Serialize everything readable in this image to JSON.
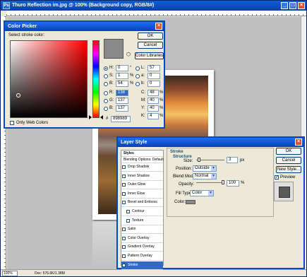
{
  "document": {
    "title": "Thuro Reflection im.jpg @ 100% (Background copy, RGB/8#)",
    "zoom": "100%",
    "info": "Doc: 576.6K/1.38M"
  },
  "color_picker": {
    "title": "Color Picker",
    "prompt": "Select stroke color:",
    "ok_label": "OK",
    "cancel_label": "Cancel",
    "libraries_label": "Color Libraries",
    "only_web_colors_label": "Only Web Colors",
    "hex_label": "#",
    "hex_value": "898989",
    "new_color": "#898989",
    "fields": {
      "H": {
        "label": "H:",
        "value": "0",
        "unit": "°"
      },
      "S": {
        "label": "S:",
        "value": "1",
        "unit": "%"
      },
      "B": {
        "label": "B:",
        "value": "54",
        "unit": "%"
      },
      "R": {
        "label": "R:",
        "value": "138"
      },
      "G": {
        "label": "G:",
        "value": "137"
      },
      "Bl": {
        "label": "B:",
        "value": "137"
      },
      "L": {
        "label": "L:",
        "value": "57"
      },
      "a": {
        "label": "a:",
        "value": "0"
      },
      "b": {
        "label": "b:",
        "value": "0"
      },
      "C": {
        "label": "C:",
        "value": "48",
        "unit": "%"
      },
      "M": {
        "label": "M:",
        "value": "40",
        "unit": "%"
      },
      "Y": {
        "label": "Y:",
        "value": "40",
        "unit": "%"
      },
      "K": {
        "label": "K:",
        "value": "4",
        "unit": "%"
      }
    }
  },
  "layer_style": {
    "title": "Layer Style",
    "styles_header": "Styles",
    "blending_options": "Blending Options: Default",
    "style_items": [
      {
        "label": "Drop Shadow",
        "checked": false
      },
      {
        "label": "Inner Shadow",
        "checked": false
      },
      {
        "label": "Outer Glow",
        "checked": false
      },
      {
        "label": "Inner Glow",
        "checked": false
      },
      {
        "label": "Bevel and Emboss",
        "checked": false
      },
      {
        "label": "Contour",
        "checked": false
      },
      {
        "label": "Texture",
        "checked": false
      },
      {
        "label": "Satin",
        "checked": false
      },
      {
        "label": "Color Overlay",
        "checked": false
      },
      {
        "label": "Gradient Overlay",
        "checked": false
      },
      {
        "label": "Pattern Overlay",
        "checked": false
      },
      {
        "label": "Stroke",
        "checked": true
      }
    ],
    "panel_title": "Stroke",
    "section_title": "Structure",
    "size_label": "Size:",
    "size_value": "3",
    "size_unit": "px",
    "size_fraction": 0.05,
    "position_label": "Position:",
    "position_value": "Outside",
    "blend_mode_label": "Blend Mode:",
    "blend_mode_value": "Normal",
    "opacity_label": "Opacity:",
    "opacity_value": "100",
    "opacity_unit": "%",
    "opacity_fraction": 1.0,
    "fill_type_label": "Fill Type:",
    "fill_type_value": "Color",
    "color_label": "Color:",
    "stroke_color": "#898989",
    "ok_label": "OK",
    "cancel_label": "Cancel",
    "new_style_label": "New Style...",
    "preview_label": "Preview",
    "preview_checked": true
  }
}
